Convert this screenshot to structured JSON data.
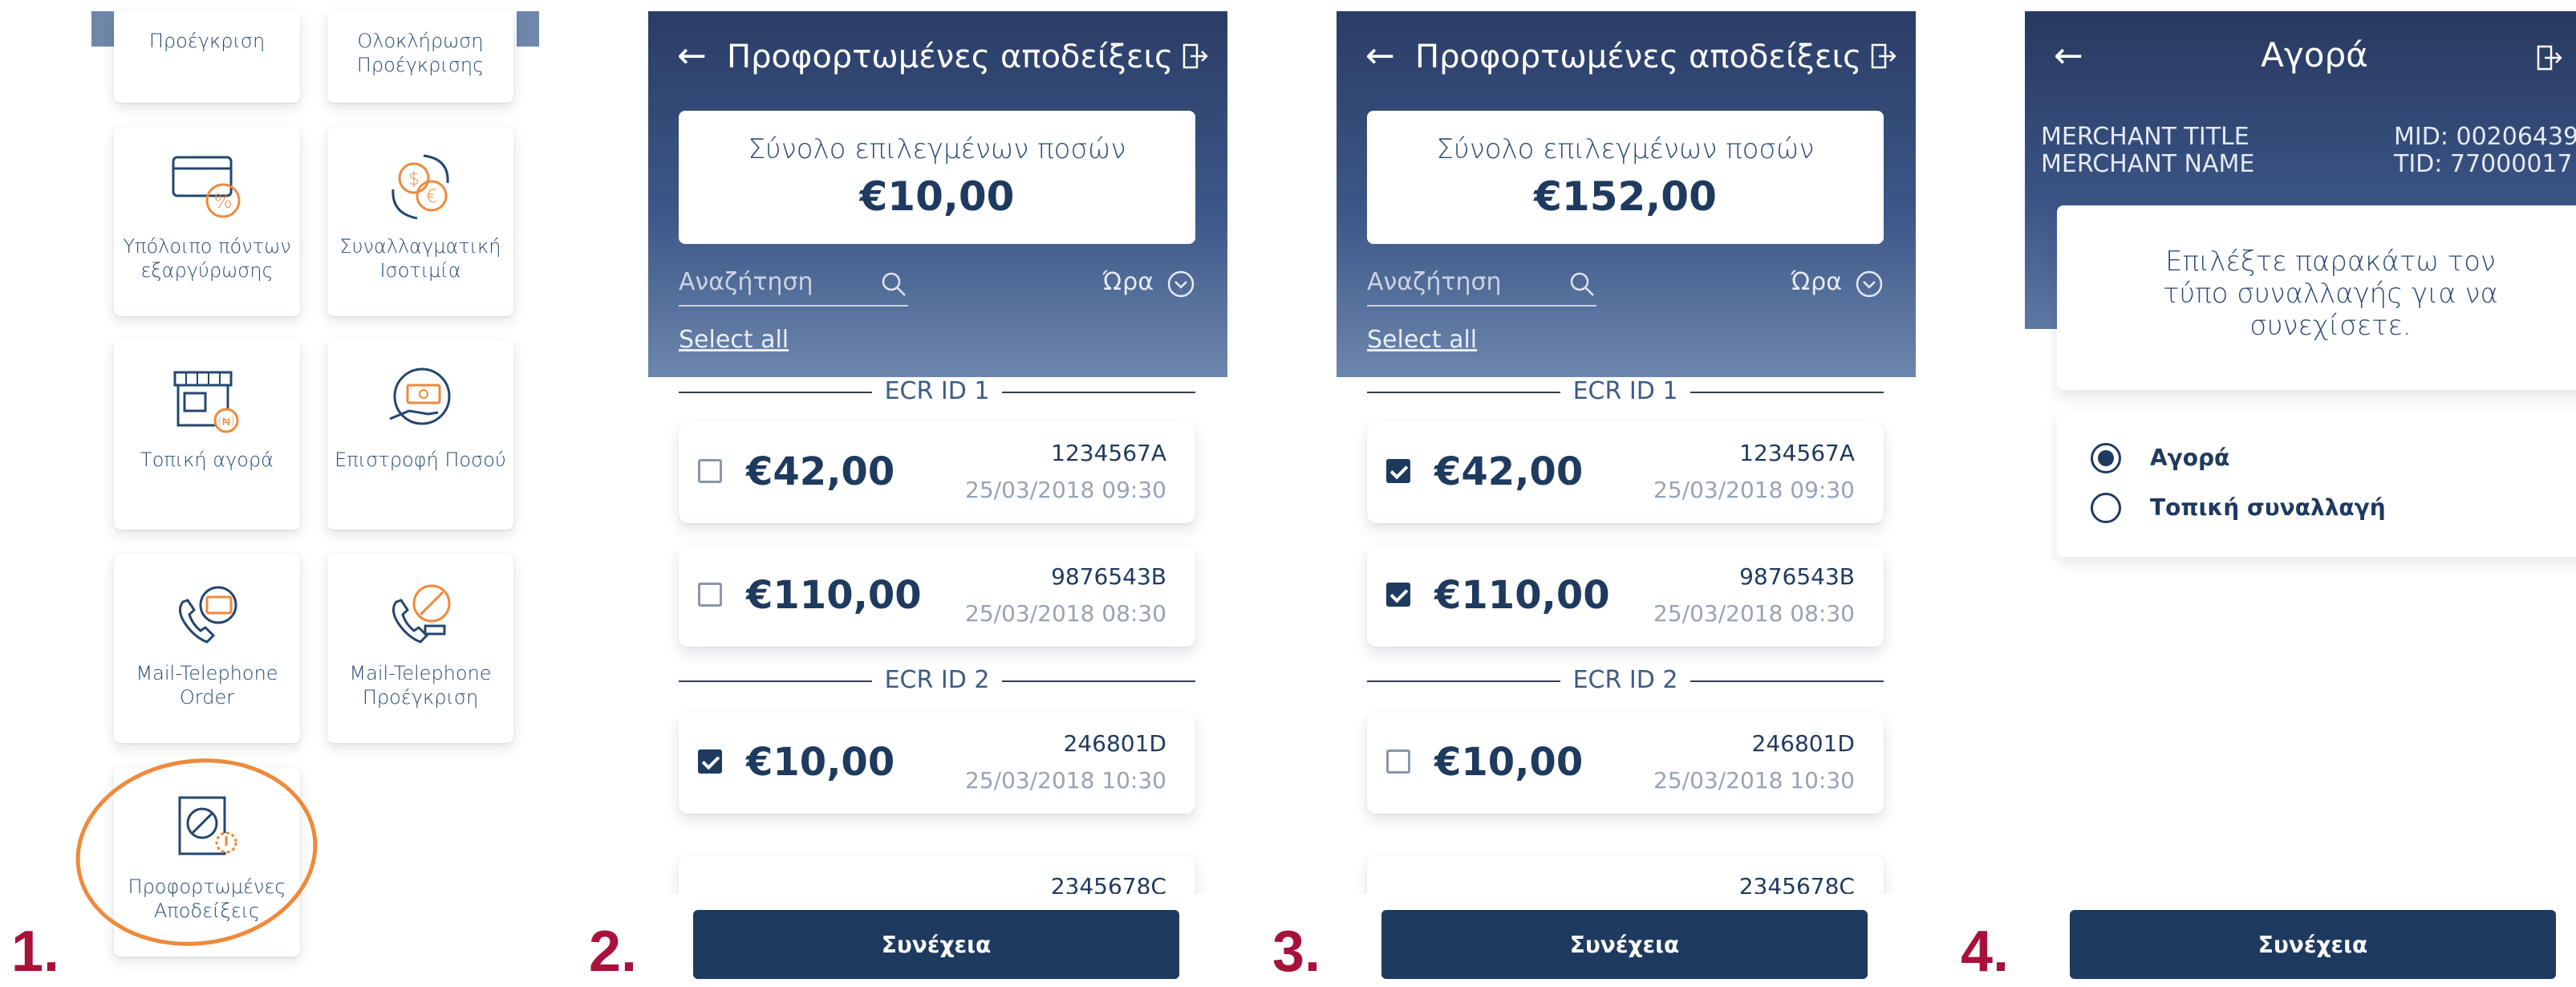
{
  "steps": [
    "1.",
    "2.",
    "3.",
    "4."
  ],
  "panel1": {
    "tiles": [
      {
        "label": "Προέγκριση",
        "icon": "preauth-icon"
      },
      {
        "label": "Ολοκλήρωση Προέγκρισης",
        "icon": "preauth-complete-icon"
      },
      {
        "label": "Υπόλοιπο πόντων εξαργύρωσης",
        "icon": "card-percent-icon"
      },
      {
        "label": "Συναλλαγματική Ισοτιμία",
        "icon": "currency-exchange-icon"
      },
      {
        "label": "Τοπική αγορά",
        "icon": "local-store-icon"
      },
      {
        "label": "Επιστροφή Ποσού",
        "icon": "refund-hand-icon"
      },
      {
        "label": "Mail-Telephone Order",
        "icon": "phone-card-icon"
      },
      {
        "label": "Mail-Telephone Προέγκριση",
        "icon": "phone-preauth-icon"
      },
      {
        "label": "Προφορτωμένες Αποδείξεις",
        "icon": "preloaded-receipts-icon"
      }
    ],
    "accent": "#ee8a3c"
  },
  "receipts_screen": {
    "title": "Προφορτωμένες αποδείξεις",
    "total_label": "Σύνολο επιλεγμένων ποσών",
    "search_placeholder": "Αναζήτηση",
    "time_label": "Ώρα",
    "select_all": "Select all",
    "groups": [
      "ECR ID 1",
      "ECR ID 2"
    ],
    "receipts": [
      {
        "amount": "€42,00",
        "ref": "1234567A",
        "datetime": "25/03/2018 09:30"
      },
      {
        "amount": "€110,00",
        "ref": "9876543B",
        "datetime": "25/03/2018 08:30"
      },
      {
        "amount": "€10,00",
        "ref": "246801D",
        "datetime": "25/03/2018 10:30"
      },
      {
        "amount": "",
        "ref": "2345678C",
        "datetime": ""
      }
    ],
    "continue": "Συνέχεια"
  },
  "panel2": {
    "total": "€10,00",
    "checked": [
      false,
      false,
      true
    ]
  },
  "panel3": {
    "total": "€152,00",
    "checked": [
      true,
      true,
      false
    ]
  },
  "panel4": {
    "title": "Αγορά",
    "merchant_title": "MERCHANT TITLE",
    "merchant_name": "MERCHANT NAME",
    "mid": "MID: 00206439",
    "tid": "TID: 77000017",
    "instruction": "Επιλέξτε παρακάτω τον τύπο συναλλαγής για να συνεχίσετε.",
    "options": [
      {
        "label": "Αγορά",
        "selected": true
      },
      {
        "label": "Τοπική συναλλαγή",
        "selected": false
      }
    ],
    "continue": "Συνέχεια"
  },
  "colors": {
    "navy": "#1f3a5f",
    "step_number": "#a8123a",
    "header_gradient_top": "#2a3d66",
    "header_gradient_bottom": "#6d86ad"
  }
}
